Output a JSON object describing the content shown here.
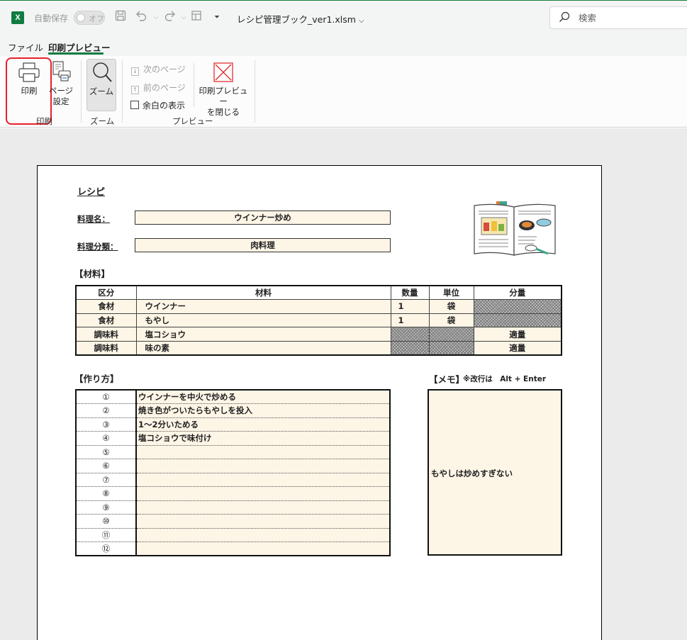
{
  "titlebar": {
    "app_logo": "X",
    "autosave_label": "自動保存",
    "autosave_state": "オフ",
    "filename": "レシピ管理ブック_ver1.xlsm",
    "search_placeholder": "検索"
  },
  "menu_tabs": [
    {
      "label": "ファイル"
    },
    {
      "label": "印刷プレビュー"
    }
  ],
  "ribbon": {
    "print_label": "印刷",
    "page_setup_label": "ページ\n設定",
    "zoom_label": "ズーム",
    "next_page_label": "次のページ",
    "prev_page_label": "前のページ",
    "show_margins_label": "余白の表示",
    "close_preview_label": "印刷プレビュー\nを閉じる",
    "groups": {
      "print": "印刷",
      "zoom": "ズーム",
      "preview": "プレビュー"
    }
  },
  "sheet": {
    "title": "レシピ",
    "dish_name_label": "料理名：",
    "dish_name_value": "ウインナー炒め",
    "category_label": "料理分類：",
    "category_value": "肉料理",
    "ingredients_heading": "【材料】",
    "ingredients_headers": [
      "区分",
      "材料",
      "数量",
      "単位",
      "分量"
    ],
    "ingredients_rows": [
      {
        "kubun": "食材",
        "zairyo": "ウインナー",
        "suryo": "1",
        "tani": "袋",
        "bunryo": ""
      },
      {
        "kubun": "食材",
        "zairyo": "もやし",
        "suryo": "1",
        "tani": "袋",
        "bunryo": ""
      },
      {
        "kubun": "調味料",
        "zairyo": "塩コショウ",
        "suryo": "",
        "tani": "",
        "bunryo": "適量"
      },
      {
        "kubun": "調味料",
        "zairyo": "味の素",
        "suryo": "",
        "tani": "",
        "bunryo": "適量"
      }
    ],
    "steps_heading": "【作り方】",
    "steps": [
      {
        "num": "①",
        "text": "ウインナーを中火で炒める"
      },
      {
        "num": "②",
        "text": "焼き色がついたらもやしを投入"
      },
      {
        "num": "③",
        "text": "1～2分いためる"
      },
      {
        "num": "④",
        "text": "塩コショウで味付け"
      },
      {
        "num": "⑤",
        "text": ""
      },
      {
        "num": "⑥",
        "text": ""
      },
      {
        "num": "⑦",
        "text": ""
      },
      {
        "num": "⑧",
        "text": ""
      },
      {
        "num": "⑨",
        "text": ""
      },
      {
        "num": "⑩",
        "text": ""
      },
      {
        "num": "⑪",
        "text": ""
      },
      {
        "num": "⑫",
        "text": ""
      }
    ],
    "memo_heading": "【メモ】",
    "memo_note": "※改行は　Alt + Enter",
    "memo_text": "もやしは炒めすぎない"
  },
  "colors": {
    "excel_green": "#107c41",
    "cell_fill": "#fdf5e6",
    "highlight_red": "#e8202a"
  }
}
